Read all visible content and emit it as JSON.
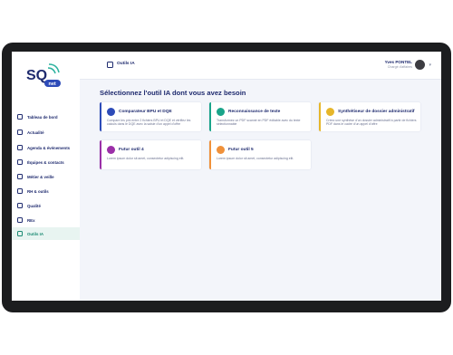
{
  "app": {
    "logo_text": "SQ",
    "logo_sub": "net"
  },
  "topbar": {
    "title": "Outils IA"
  },
  "user": {
    "name": "Yves PONTEL",
    "role": "Chargé d'affaires"
  },
  "sidebar": {
    "items": [
      {
        "label": "Tableau de bord",
        "icon": "dashboard-icon"
      },
      {
        "label": "Actualité",
        "icon": "news-icon"
      },
      {
        "label": "Agenda & événements",
        "icon": "calendar-icon"
      },
      {
        "label": "Équipes & contacts",
        "icon": "team-icon"
      },
      {
        "label": "Métier & veille",
        "icon": "briefcase-icon"
      },
      {
        "label": "RH & outils",
        "icon": "tools-icon"
      },
      {
        "label": "Qualité",
        "icon": "quality-icon"
      },
      {
        "label": "REx",
        "icon": "feedback-icon"
      },
      {
        "label": "Outils IA",
        "icon": "ai-icon",
        "active": true
      }
    ]
  },
  "main": {
    "heading": "Sélectionnez l'outil IA dont vous avez besoin",
    "cards": [
      {
        "title": "Comparateur BPU et DQE",
        "desc": "Compare les prix entre 2 fichiers BPU et DQE et vérifiez les calculs dans le DQE avec la saisie d'un appel d'offre",
        "color": "#2d4bb8",
        "icon": "compare-icon"
      },
      {
        "title": "Reconnaissance de texte",
        "desc": "Transformez un PDF scanné en PDF éditable avec du texte sélectionnable",
        "color": "#1aa48a",
        "icon": "text-recognition-icon"
      },
      {
        "title": "Synthétiseur de dossier administratif",
        "desc": "Créez une synthèse d'un dossier administratif à partir de fichiers PDF dans le cadre d'un appel d'offre",
        "color": "#e6b62a",
        "icon": "document-summary-icon"
      },
      {
        "title": "Futur outil 4",
        "desc": "Lorem ipsum dolor sit amet, consectetur adipiscing elit.",
        "color": "#9b2fa8",
        "icon": "future-tool-icon"
      },
      {
        "title": "Futur outil 5",
        "desc": "Lorem ipsum dolor sit amet, consectetur adipiscing elit.",
        "color": "#f0913a",
        "icon": "future-tool-icon"
      }
    ]
  }
}
